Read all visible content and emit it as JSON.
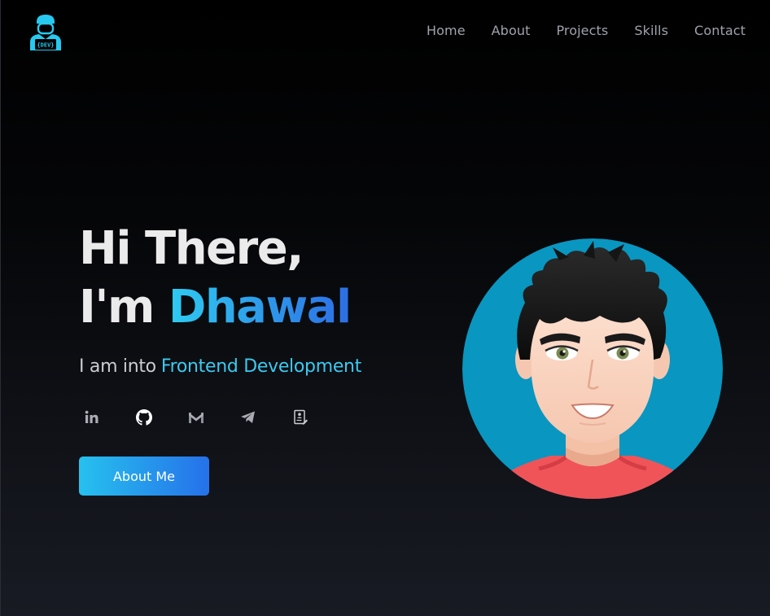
{
  "nav": {
    "items": [
      {
        "label": "Home"
      },
      {
        "label": "About"
      },
      {
        "label": "Projects"
      },
      {
        "label": "Skills"
      },
      {
        "label": "Contact"
      }
    ]
  },
  "logo": {
    "text": "{DEV}",
    "icon": "developer-logo-icon",
    "color": "#27c9f0"
  },
  "hero": {
    "greeting": "Hi There,",
    "intro": "I'm ",
    "name": "Dhawal",
    "tagline_prefix": "I am into",
    "tagline_typed": "Frontend Development"
  },
  "socials": [
    {
      "icon": "linkedin-icon"
    },
    {
      "icon": "github-icon"
    },
    {
      "icon": "gmail-icon"
    },
    {
      "icon": "telegram-icon"
    },
    {
      "icon": "resume-icon"
    }
  ],
  "cta": {
    "label": "About Me"
  },
  "colors": {
    "accent_start": "#2ecbf0",
    "accent_end": "#2d6de6",
    "avatar_background": "#0a96bf",
    "nav_text": "#9ea3ab"
  }
}
